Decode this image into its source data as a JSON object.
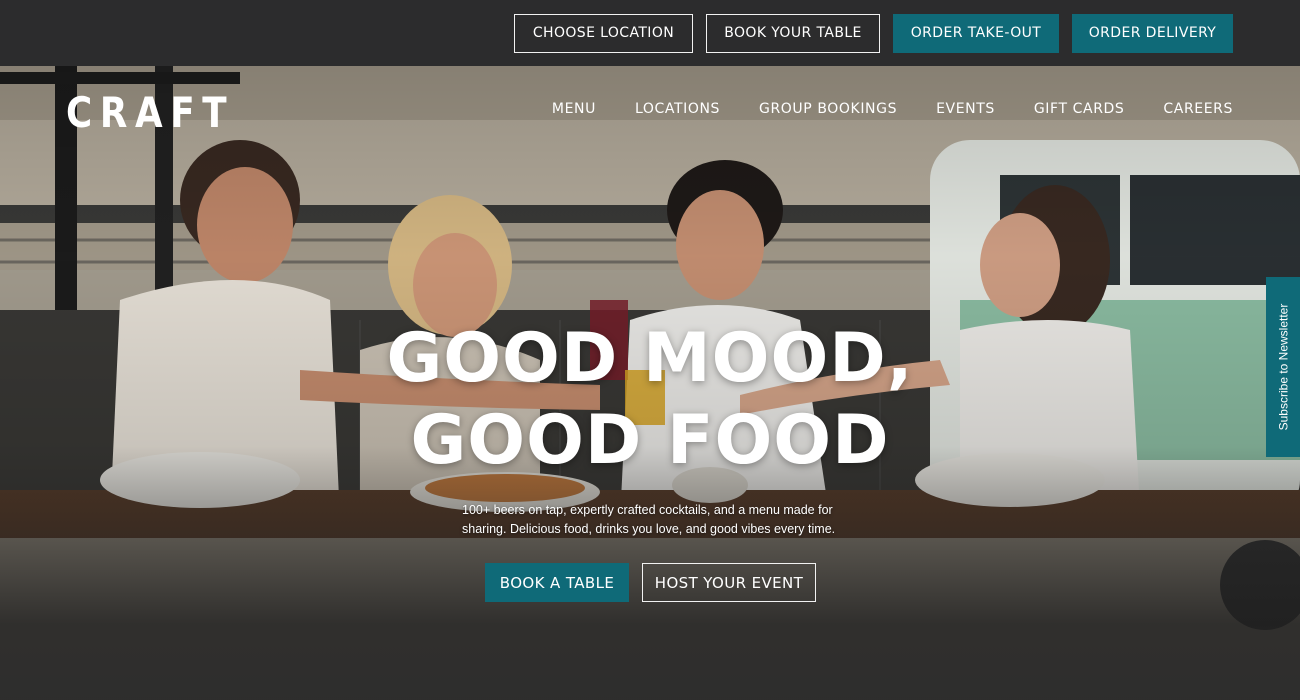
{
  "topbar": {
    "buttons": [
      {
        "label": "CHOOSE LOCATION"
      },
      {
        "label": "BOOK YOUR TABLE"
      },
      {
        "label": "ORDER TAKE-OUT"
      },
      {
        "label": "ORDER DELIVERY"
      }
    ]
  },
  "brand": {
    "logo_text": "CRAFT"
  },
  "nav": {
    "items": [
      {
        "label": "MENU"
      },
      {
        "label": "LOCATIONS"
      },
      {
        "label": "GROUP BOOKINGS"
      },
      {
        "label": "EVENTS"
      },
      {
        "label": "GIFT CARDS"
      },
      {
        "label": "CAREERS"
      }
    ]
  },
  "hero": {
    "headline_line1": "GOOD MOOD,",
    "headline_line2": "GOOD FOOD",
    "subtext": "100+ beers on tap, expertly crafted cocktails, and a menu made for sharing. Delicious food, drinks you love, and good vibes every time.",
    "cta_primary": "BOOK A TABLE",
    "cta_secondary": "HOST YOUR EVENT"
  },
  "newsletter": {
    "label": "Subscribe to Newsletter"
  },
  "colors": {
    "accent": "#0f6a78",
    "topbar": "#2c2c2d",
    "text": "#ffffff"
  }
}
